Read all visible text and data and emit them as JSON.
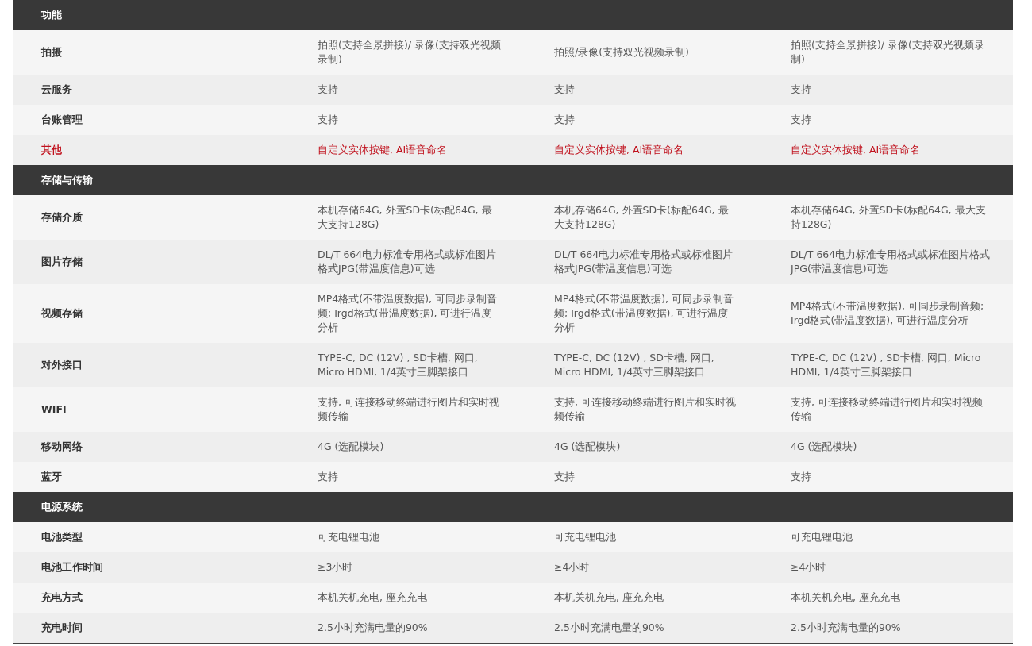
{
  "sections": [
    {
      "title": "功能",
      "rows": [
        {
          "label": "拍摄",
          "highlight": false,
          "values": [
            "拍照(支持全景拼接)/ 录像(支持双光视频录制)",
            "拍照/录像(支持双光视频录制)",
            "拍照(支持全景拼接)/ 录像(支持双光视频录制)"
          ]
        },
        {
          "label": "云服务",
          "highlight": false,
          "values": [
            "支持",
            "支持",
            "支持"
          ]
        },
        {
          "label": "台账管理",
          "highlight": false,
          "values": [
            "支持",
            "支持",
            "支持"
          ]
        },
        {
          "label": "其他",
          "highlight": true,
          "values": [
            "自定义实体按键, AI语音命名",
            "自定义实体按键, AI语音命名",
            "自定义实体按键, AI语音命名"
          ]
        }
      ]
    },
    {
      "title": "存储与传输",
      "rows": [
        {
          "label": "存储介质",
          "highlight": false,
          "values": [
            "本机存储64G, 外置SD卡(标配64G, 最大支持128G)",
            "本机存储64G, 外置SD卡(标配64G, 最大支持128G)",
            "本机存储64G, 外置SD卡(标配64G, 最大支持128G)"
          ]
        },
        {
          "label": "图片存储",
          "highlight": false,
          "values": [
            "DL/T 664电力标准专用格式或标准图片格式JPG(带温度信息)可选",
            "DL/T 664电力标准专用格式或标准图片格式JPG(带温度信息)可选",
            "DL/T 664电力标准专用格式或标准图片格式JPG(带温度信息)可选"
          ]
        },
        {
          "label": "视频存储",
          "highlight": false,
          "values": [
            "MP4格式(不带温度数据), 可同步录制音频; Irgd格式(带温度数据), 可进行温度分析",
            "MP4格式(不带温度数据), 可同步录制音频; Irgd格式(带温度数据), 可进行温度分析",
            "MP4格式(不带温度数据), 可同步录制音频; Irgd格式(带温度数据), 可进行温度分析"
          ]
        },
        {
          "label": "对外接口",
          "highlight": false,
          "values": [
            "TYPE-C, DC (12V) , SD卡槽, 网口, Micro HDMI, 1/4英寸三脚架接口",
            "TYPE-C, DC (12V) , SD卡槽, 网口, Micro HDMI, 1/4英寸三脚架接口",
            "TYPE-C, DC (12V) , SD卡槽, 网口, Micro HDMI, 1/4英寸三脚架接口"
          ]
        },
        {
          "label": "WIFI",
          "highlight": false,
          "values": [
            "支持, 可连接移动终端进行图片和实时视频传输",
            "支持, 可连接移动终端进行图片和实时视频传输",
            "支持, 可连接移动终端进行图片和实时视频传输"
          ]
        },
        {
          "label": "移动网络",
          "highlight": false,
          "values": [
            "4G (选配模块)",
            "4G (选配模块)",
            "4G (选配模块)"
          ]
        },
        {
          "label": "蓝牙",
          "highlight": false,
          "values": [
            "支持",
            "支持",
            "支持"
          ]
        }
      ]
    },
    {
      "title": "电源系统",
      "rows": [
        {
          "label": "电池类型",
          "highlight": false,
          "values": [
            "可充电锂电池",
            "可充电锂电池",
            "可充电锂电池"
          ]
        },
        {
          "label": "电池工作时间",
          "highlight": false,
          "values": [
            "≥3小时",
            "≥4小时",
            "≥4小时"
          ]
        },
        {
          "label": "充电方式",
          "highlight": false,
          "values": [
            "本机关机充电, 座充充电",
            "本机关机充电, 座充充电",
            "本机关机充电, 座充充电"
          ]
        },
        {
          "label": "充电时间",
          "highlight": false,
          "values": [
            "2.5小时充满电量的90%",
            "2.5小时充满电量的90%",
            "2.5小时充满电量的90%"
          ]
        }
      ]
    }
  ]
}
